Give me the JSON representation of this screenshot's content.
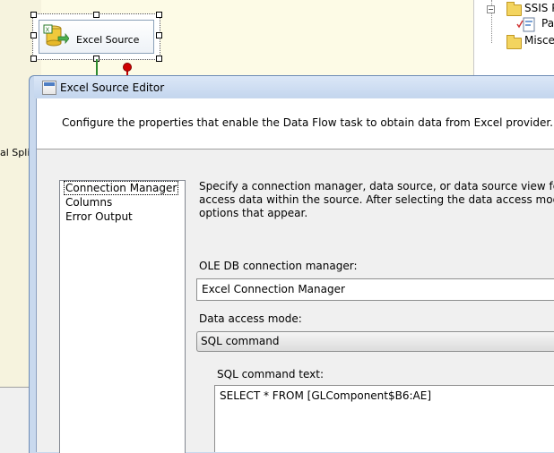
{
  "designer": {
    "component_label": "Excel Source",
    "split_label": "al Split D"
  },
  "solution_explorer": {
    "items": [
      {
        "label": "SSIS Pa",
        "icon": "folder-icon"
      },
      {
        "label": "Pa",
        "icon": "package-file-icon"
      },
      {
        "label": "Miscel",
        "icon": "folder-icon"
      }
    ]
  },
  "dialog": {
    "title": "Excel Source Editor",
    "header_text": "Configure the properties that enable the Data Flow task to obtain data from Excel provider.",
    "nav_items": [
      "Connection Manager",
      "Columns",
      "Error Output"
    ],
    "description_lines": [
      "Specify a connection manager, data source, or data source view for the Exce",
      "access data within the source. After selecting the data access mode, select f",
      "options that appear."
    ],
    "connection_manager": {
      "label": "OLE DB connection manager:",
      "value": "Excel Connection Manager"
    },
    "data_access_mode": {
      "label": "Data access mode:",
      "value": "SQL command"
    },
    "sql_command": {
      "label": "SQL command text:",
      "value": "SELECT * FROM [GLComponent$B6:AE]"
    }
  },
  "colors": {
    "dialog_frame": "#c9d9ee",
    "designer_bg": "#fdfbe6",
    "success_path": "#2e8b2e",
    "error_path": "#c00000"
  }
}
